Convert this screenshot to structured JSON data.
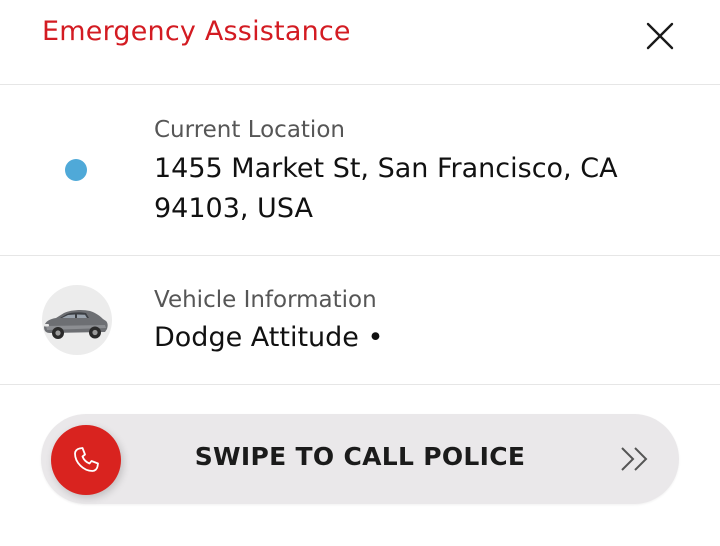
{
  "header": {
    "title": "Emergency Assistance",
    "close_icon": "close-icon"
  },
  "location": {
    "label": "Current Location",
    "address": "1455 Market St, San Francisco, CA 94103, USA",
    "marker_color": "#4fa9d8"
  },
  "vehicle": {
    "label": "Vehicle Information",
    "name": "Dodge Attitude •",
    "icon": "car-icon"
  },
  "swipe": {
    "label": "SWIPE TO CALL POLICE",
    "knob_icon": "phone-icon",
    "arrow_icon": "double-chevron-right-icon",
    "accent_color": "#d9231f"
  },
  "colors": {
    "title": "#d31b22",
    "track": "#eae8ea"
  }
}
